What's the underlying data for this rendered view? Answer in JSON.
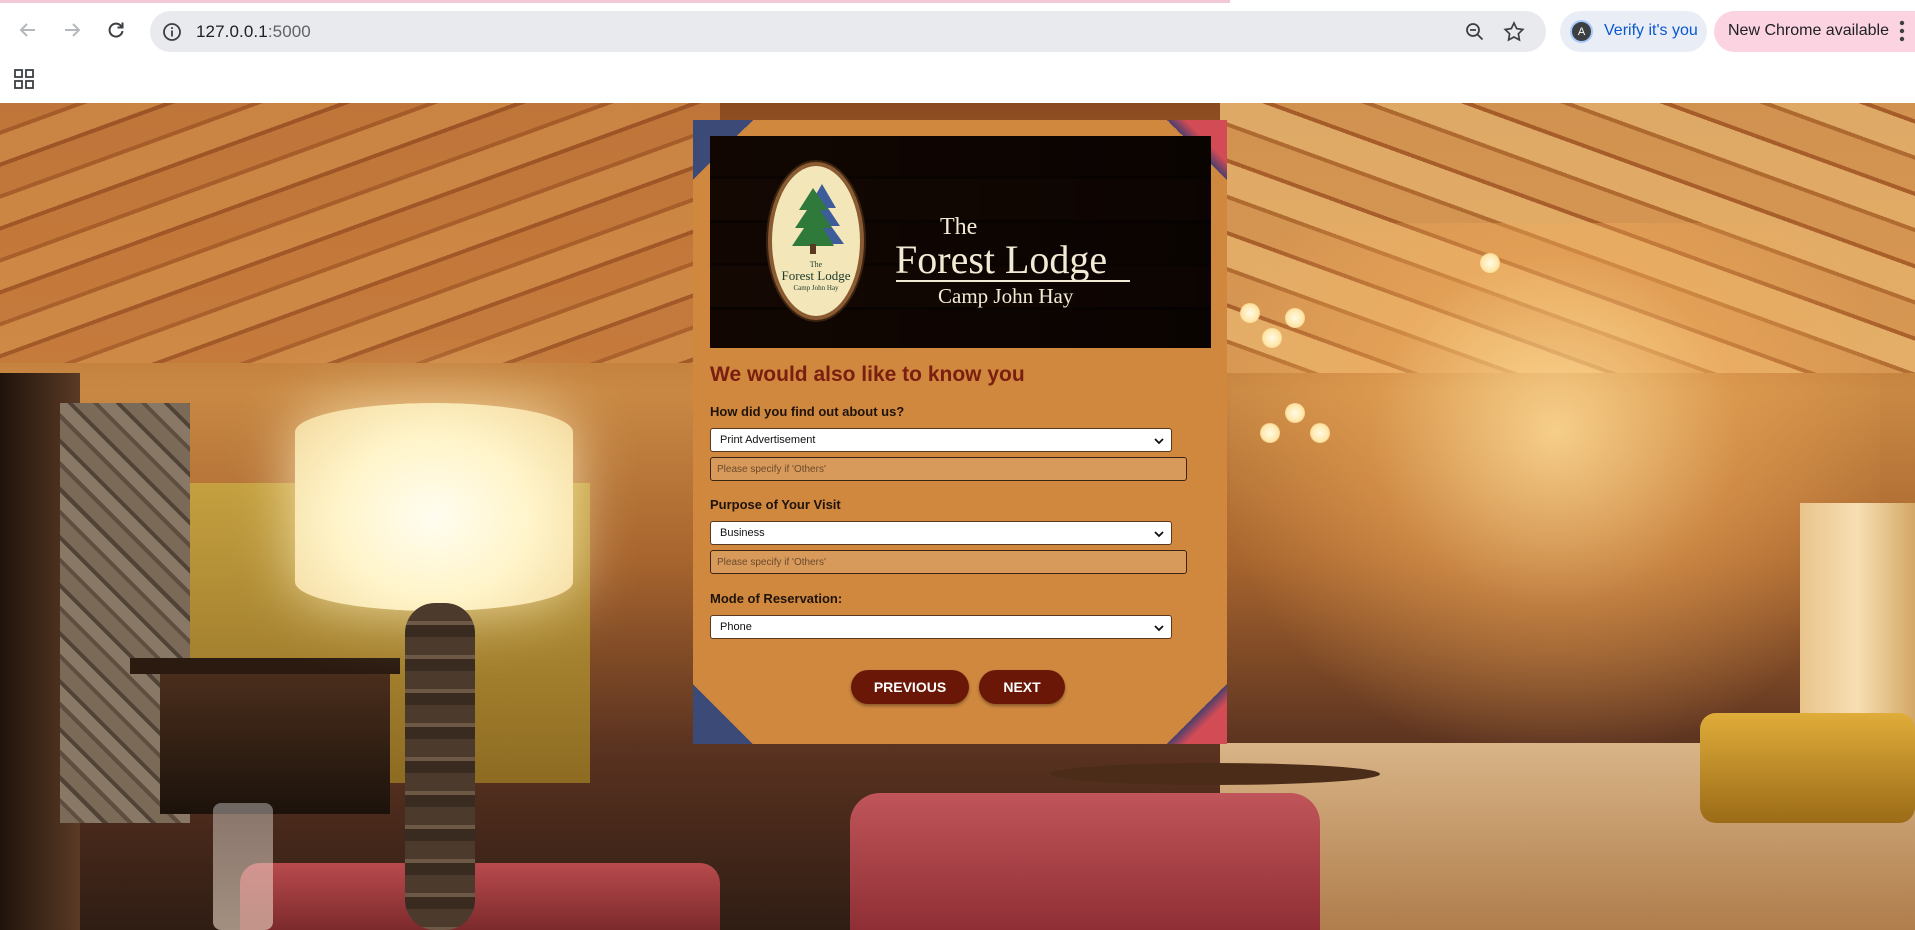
{
  "browser": {
    "url_host": "127.0.0.1",
    "url_port": ":5000",
    "verify_label": "Verify it's you",
    "avatar_letter": "A",
    "update_label": "New Chrome available"
  },
  "banner": {
    "oval_the": "The",
    "oval_name": "Forest Lodge",
    "oval_sub": "Camp John Hay",
    "brand_the": "The",
    "brand_name": "Forest Lodge",
    "brand_sub": "Camp John Hay"
  },
  "form": {
    "title": "We would also like to know you",
    "q_find_label": "How did you find out about us?",
    "q_find_value": "Print Advertisement",
    "q_find_other_placeholder": "Please specify if 'Others'",
    "q_purpose_label": "Purpose of Your Visit",
    "q_purpose_value": "Business",
    "q_purpose_other_placeholder": "Please specify if 'Others'",
    "q_mode_label": "Mode of Reservation:",
    "q_mode_value": "Phone",
    "prev_label": "PREVIOUS",
    "next_label": "NEXT"
  },
  "colors": {
    "card": "#d0883f",
    "title": "#7a1e0f",
    "button": "#6b1707"
  }
}
